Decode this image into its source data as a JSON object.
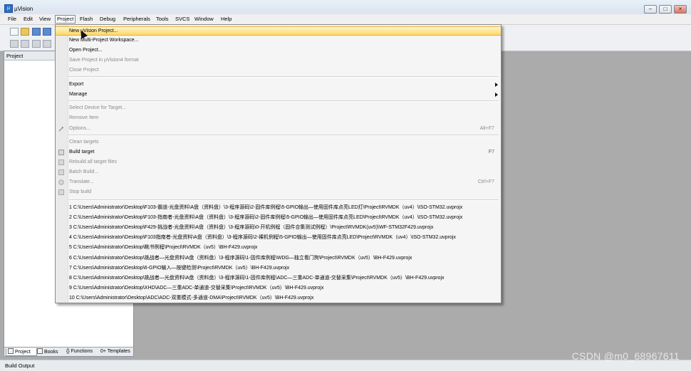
{
  "window": {
    "title": "µVision"
  },
  "menubar": [
    "File",
    "Edit",
    "View",
    "Project",
    "Flash",
    "Debug",
    "Peripherals",
    "Tools",
    "SVCS",
    "Window",
    "Help"
  ],
  "project_pane": {
    "title": "Project",
    "tabs": [
      "Project",
      "Books",
      "{} Functions",
      "0+ Templates"
    ]
  },
  "statusbar": {
    "text": "Build Output"
  },
  "watermark": "CSDN @m0_68967611",
  "project_menu": {
    "items": [
      {
        "label": "New µVision Project...",
        "shortcut": "",
        "submenu": false,
        "disabled": false
      },
      {
        "label": "New Multi-Project Workspace...",
        "shortcut": "",
        "submenu": false,
        "disabled": false
      },
      {
        "label": "Open Project...",
        "shortcut": "",
        "submenu": false,
        "disabled": false
      },
      {
        "label": "Save Project in µVision4 format",
        "shortcut": "",
        "submenu": false,
        "disabled": true
      },
      {
        "label": "Close Project",
        "shortcut": "",
        "submenu": false,
        "disabled": true
      },
      {
        "label": "Export",
        "shortcut": "",
        "submenu": true,
        "disabled": false
      },
      {
        "label": "Manage",
        "shortcut": "",
        "submenu": true,
        "disabled": false
      },
      {
        "label": "Select Device for Target...",
        "shortcut": "",
        "submenu": false,
        "disabled": true
      },
      {
        "label": "Remove Item",
        "shortcut": "",
        "submenu": false,
        "disabled": true
      },
      {
        "label": "Options...",
        "shortcut": "Alt+F7",
        "submenu": false,
        "disabled": true
      },
      {
        "label": "Clean targets",
        "shortcut": "",
        "submenu": false,
        "disabled": true
      },
      {
        "label": "Build target",
        "shortcut": "F7",
        "submenu": false,
        "disabled": false
      },
      {
        "label": "Rebuild all target files",
        "shortcut": "",
        "submenu": false,
        "disabled": true
      },
      {
        "label": "Batch Build...",
        "shortcut": "",
        "submenu": false,
        "disabled": true
      },
      {
        "label": "Translate...",
        "shortcut": "Ctrl+F7",
        "submenu": false,
        "disabled": true
      },
      {
        "label": "Stop build",
        "shortcut": "",
        "submenu": false,
        "disabled": true
      }
    ],
    "recent": [
      "1 C:\\Users\\Administrator\\Desktop\\F103-霸道-光盘资料\\A盘（资料盘）\\3-程序源码\\2-固件库例程\\5-GPIO输出—使用固件库点亮LED灯\\Project\\RVMDK（uv4）\\ISO-STM32.uvprojx",
      "2 C:\\Users\\Administrator\\Desktop\\F103-指南者-光盘资料\\A盘（资料盘）\\3-程序源码\\2-固件库例程\\5-GPIO输出—使用固件库点亮LED\\Project\\RVMDK（uv4）\\ISO-STM32.uvprojx",
      "3 C:\\Users\\Administrator\\Desktop\\F429-挑战者-光盘资料\\A盘（资料盘）\\3-程序源码\\0-开机例程（固件合集测试例程）\\Project\\RVMDK(uv5)\\WF-STM32F429.uvprojx",
      "4 C:\\Users\\Administrator\\Desktop\\F103指南者-光盘资料\\A盘（资料盘）\\3-程序源码\\2-裸机例程\\5-GPIO输出—使用固件库点亮LED\\Project\\RVMDK（uv4）\\ISO-STM32.uvprojx",
      "5 C:\\Users\\Administrator\\Desktop\\眺书例程\\Project\\RVMDK（uv5）\\BH-F429.uvprojx",
      "6 C:\\Users\\Administrator\\Desktop\\挑战者—光盘资料\\A盘（资料盘）\\3-程序源码\\1-固件库例程\\WDG—独立看门狗\\Project\\RVMDK（uv5）\\BH-F429.uvprojx",
      "7 C:\\Users\\Administrator\\Desktop\\6-GPIO输入—按键检测\\Project\\RVMDK（uv5）\\BH-F429.uvprojx",
      "8 C:\\Users\\Administrator\\Desktop\\挑战者—光盘资料\\A盘（资料盘）\\3-程序源码\\1-固件库例程\\ADC—三重ADC-单通道-交替采集\\Project\\RVMDK（uv5）\\BH-F429.uvprojx",
      "9 C:\\Users\\Administrator\\Desktop\\XHD\\ADC—三重ADC-单通道-交替采集\\Project\\RVMDK（uv5）\\BH-F429.uvprojx",
      "10 C:\\Users\\Administrator\\Desktop\\ADC\\ADC-双重模式-多通道-DMA\\Project\\RVMDK（uv5）\\BH-F429.uvprojx"
    ]
  }
}
